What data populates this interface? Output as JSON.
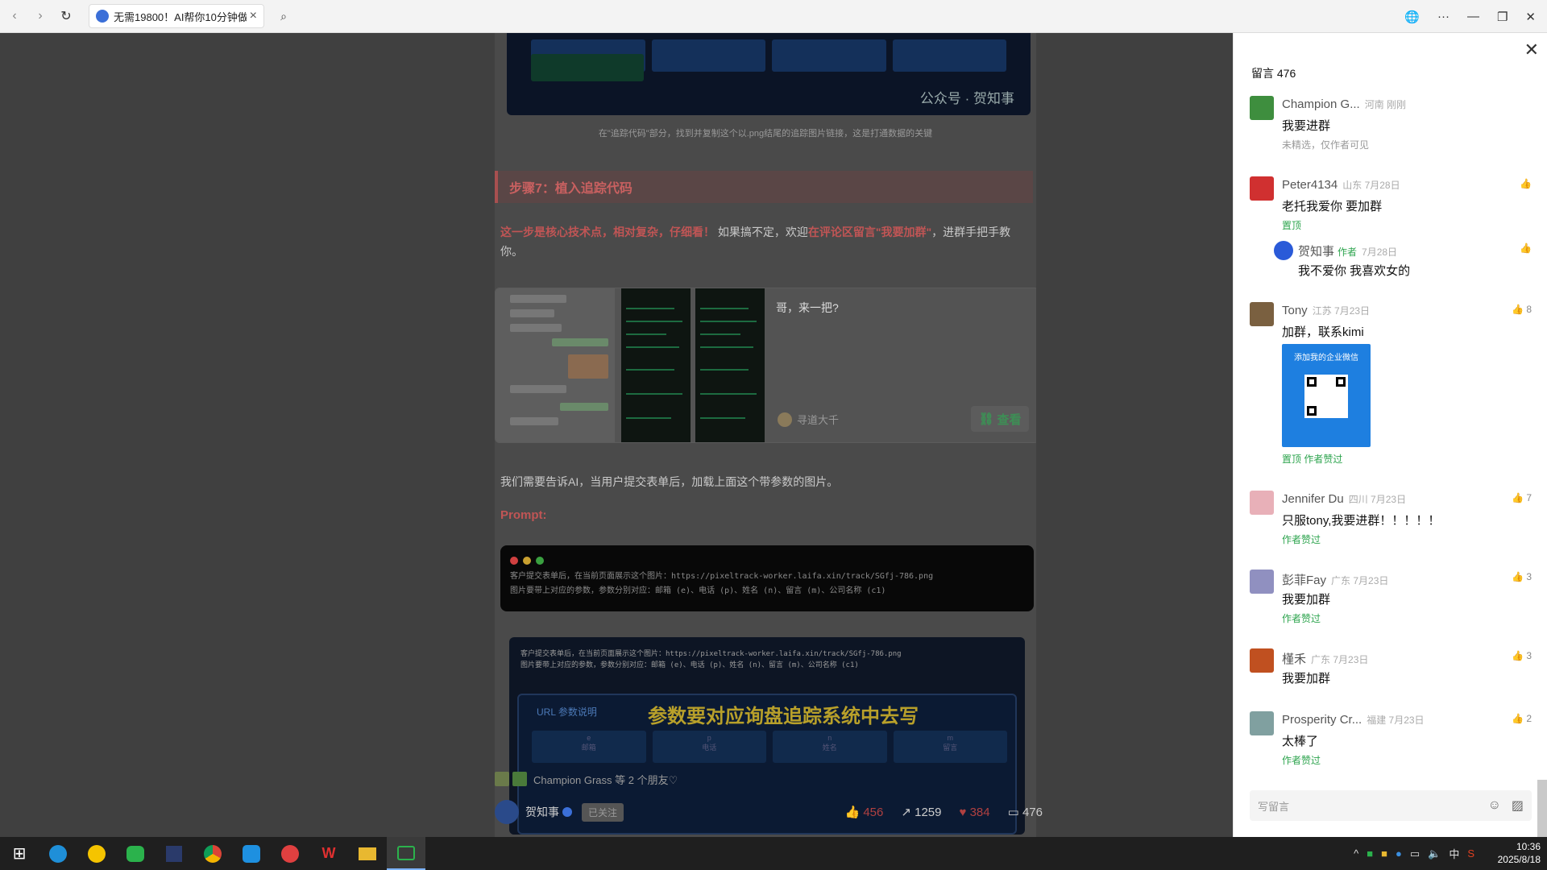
{
  "browser": {
    "tab_title": "无需19800！AI帮你10分钟做",
    "close": "×",
    "back": "‹",
    "forward": "›",
    "reload": "↻",
    "search": "⌕",
    "globe": "🌐",
    "more": "···",
    "minimize": "—",
    "restore": "❐",
    "close_window": "✕"
  },
  "article": {
    "image_watermark": "公众号 · 贺知事",
    "image_caption": "在\"追踪代码\"部分，找到并复制这个以.png结尾的追踪图片链接，这是打通数据的关键",
    "step_title": "步骤7：植入追踪代码",
    "para1_red1": "这一步是核心技术点，相对复杂，仔细看！",
    "para1_mid": " 如果搞不定，欢迎",
    "para1_red2": "在评论区留言\"我要加群\"",
    "para1_end": "，进群手把手教你。",
    "card_title": "哥，来一把?",
    "card_author": "寻道大千",
    "card_view": "查看",
    "para2": "我们需要告诉AI，当用户提交表单后，加载上面这个带参数的图片。",
    "prompt_label": "Prompt:",
    "code_line1": "客户提交表单后，在当前页面展示这个图片：https://pixeltrack-worker.laifa.xin/track/SGfj-786.png",
    "code_line2": "图片要带上对应的参数，参数分别对应：邮箱 (e)、电话 (p)、姓名 (n)、留言 (m)、公司名称 (c1)",
    "shot_line1": "客户提交表单后，在当前页面展示这个图片：https://pixeltrack-worker.laifa.xin/track/SGfj-786.png",
    "shot_line2": "图片要带上对应的参数，参数分别对应：邮箱 (e)、电话 (p)、姓名 (n)、留言 (m)、公司名称 (c1)",
    "shot_label": "URL 参数说明",
    "shot_banner": "参数要对应询盘追踪系统中去写",
    "shot_cells": [
      "e",
      "p",
      "n",
      "m"
    ],
    "shot_cell_labels": [
      "邮箱",
      "电话",
      "姓名",
      "留言"
    ],
    "friends_text": "Champion Grass 等 2 个朋友♡",
    "account_name": "贺知事",
    "follow_label": "已关注",
    "likes": "456",
    "shares": "1259",
    "loves": "384",
    "comments_count": "476"
  },
  "comments_panel": {
    "header": "留言 476",
    "close": "✕",
    "input_placeholder": "写留言",
    "emoji_icon": "☺",
    "image_icon": "▨",
    "items": [
      {
        "name": "Champion G...",
        "loc": "河南 刚刚",
        "text": "我要进群",
        "note": "未精选，仅作者可见",
        "color": "#3e8e3e"
      },
      {
        "name": "Peter4134",
        "loc": "山东 7月28日",
        "text": "老托我爱你 要加群",
        "green": "置顶",
        "color": "#d03030"
      },
      {
        "name": "贺知事",
        "auth": "作者",
        "loc": "7月28日",
        "text": "我不爱你  我喜欢女的",
        "color": "#2a5ad8"
      },
      {
        "name": "Tony",
        "loc": "江苏 7月23日",
        "text": "加群，联系kimi",
        "likes": "8",
        "green": "置顶 作者赞过",
        "qr_title": "添加我的企业微信",
        "color": "#7a6040"
      },
      {
        "name": "Jennifer Du",
        "loc": "四川 7月23日",
        "text": "只服tony,我要进群！！！！！",
        "likes": "7",
        "green": "作者赞过",
        "color": "#e8b0b8"
      },
      {
        "name": "彭菲Fay",
        "loc": "广东 7月23日",
        "text": "我要加群",
        "likes": "3",
        "green": "作者赞过",
        "color": "#9090c0"
      },
      {
        "name": "槿禾",
        "loc": "广东 7月23日",
        "text": "我要加群",
        "likes": "3",
        "color": "#c05020"
      },
      {
        "name": "Prosperity Cr...",
        "loc": "福建 7月23日",
        "text": "太棒了",
        "likes": "2",
        "green": "作者赞过",
        "color": "#80a0a0"
      }
    ]
  },
  "taskbar": {
    "start": "⊞",
    "apps": [
      "edge",
      "chrome-canary",
      "wechat",
      "tool",
      "chrome",
      "browser",
      "gmail",
      "wps",
      "explorer",
      "screen"
    ],
    "tray_lang": "中",
    "time": "10:36",
    "date": "2025/8/18"
  }
}
